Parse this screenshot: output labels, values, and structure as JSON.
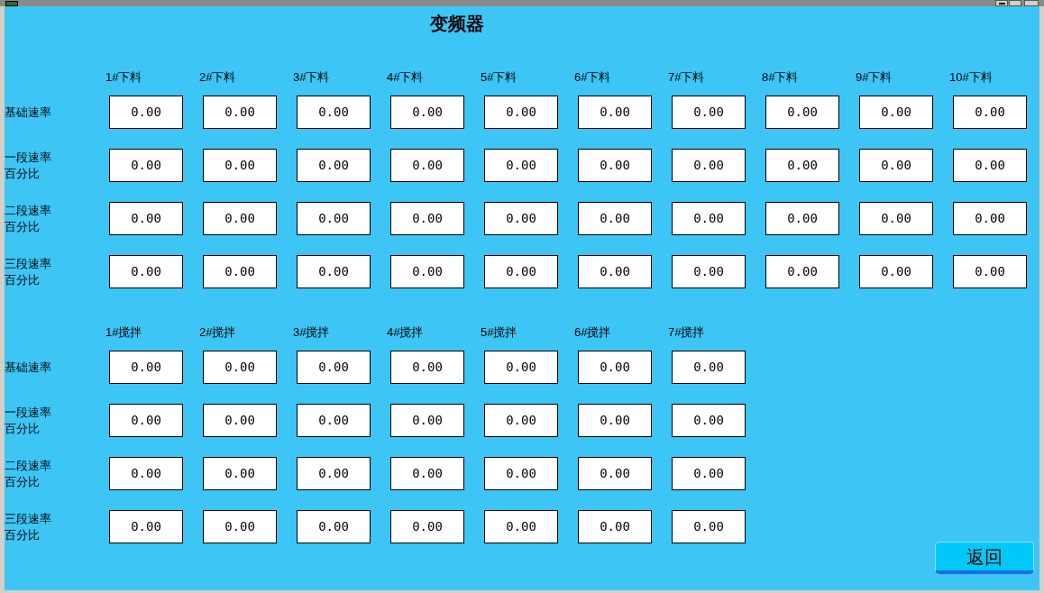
{
  "title": "变频器",
  "sections": [
    {
      "columns": [
        "1#下料",
        "2#下料",
        "3#下料",
        "4#下料",
        "5#下料",
        "6#下料",
        "7#下料",
        "8#下料",
        "9#下料",
        "10#下料"
      ],
      "rows": [
        {
          "label_lines": [
            "基础速率"
          ],
          "values": [
            "0.00",
            "0.00",
            "0.00",
            "0.00",
            "0.00",
            "0.00",
            "0.00",
            "0.00",
            "0.00",
            "0.00"
          ]
        },
        {
          "label_lines": [
            "一段速率",
            "百分比"
          ],
          "values": [
            "0.00",
            "0.00",
            "0.00",
            "0.00",
            "0.00",
            "0.00",
            "0.00",
            "0.00",
            "0.00",
            "0.00"
          ]
        },
        {
          "label_lines": [
            "二段速率",
            "百分比"
          ],
          "values": [
            "0.00",
            "0.00",
            "0.00",
            "0.00",
            "0.00",
            "0.00",
            "0.00",
            "0.00",
            "0.00",
            "0.00"
          ]
        },
        {
          "label_lines": [
            "三段速率",
            "百分比"
          ],
          "values": [
            "0.00",
            "0.00",
            "0.00",
            "0.00",
            "0.00",
            "0.00",
            "0.00",
            "0.00",
            "0.00",
            "0.00"
          ]
        }
      ]
    },
    {
      "columns": [
        "1#搅拌",
        "2#搅拌",
        "3#搅拌",
        "4#搅拌",
        "5#搅拌",
        "6#搅拌",
        "7#搅拌"
      ],
      "rows": [
        {
          "label_lines": [
            "基础速率"
          ],
          "values": [
            "0.00",
            "0.00",
            "0.00",
            "0.00",
            "0.00",
            "0.00",
            "0.00"
          ]
        },
        {
          "label_lines": [
            "一段速率",
            "百分比"
          ],
          "values": [
            "0.00",
            "0.00",
            "0.00",
            "0.00",
            "0.00",
            "0.00",
            "0.00"
          ]
        },
        {
          "label_lines": [
            "二段速率",
            "百分比"
          ],
          "values": [
            "0.00",
            "0.00",
            "0.00",
            "0.00",
            "0.00",
            "0.00",
            "0.00"
          ]
        },
        {
          "label_lines": [
            "三段速率",
            "百分比"
          ],
          "values": [
            "0.00",
            "0.00",
            "0.00",
            "0.00",
            "0.00",
            "0.00",
            "0.00"
          ]
        }
      ]
    }
  ],
  "back_button": "返回"
}
